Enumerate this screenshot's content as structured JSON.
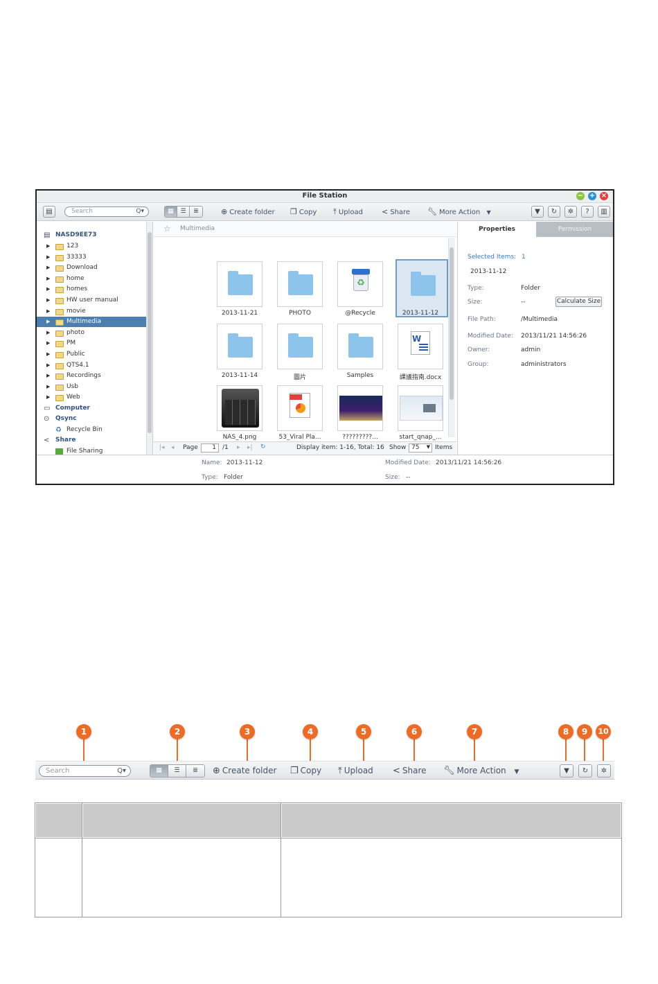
{
  "window": {
    "title": "File Station",
    "controls": {
      "minimize": "−",
      "maximize": "+",
      "close": "×"
    }
  },
  "toolbar": {
    "search_placeholder": "Search",
    "search_icon": "Q▾",
    "view_modes": [
      "thumbnail-view-icon",
      "list-view-icon",
      "detail-view-icon"
    ],
    "create_folder": "Create folder",
    "copy": "Copy",
    "upload": "Upload",
    "share": "Share",
    "more_action": "More Action",
    "right_icons": [
      "filter-icon",
      "refresh-icon",
      "settings-icon",
      "help-icon",
      "panel-icon"
    ]
  },
  "tree": {
    "root": "NASD9EE73",
    "items": [
      "123",
      "33333",
      "Download",
      "home",
      "homes",
      "HW user manual",
      "movie",
      "Multimedia",
      "photo",
      "PM",
      "Public",
      "QTS4.1",
      "Recordings",
      "Usb",
      "Web"
    ],
    "selected_index": 7,
    "computer": "Computer",
    "qsync": "Qsync",
    "recycle_bin": "Recycle Bin",
    "share": "Share",
    "file_sharing": "File Sharing"
  },
  "center": {
    "breadcrumb": "Multimedia",
    "files": [
      {
        "name": "2013-11-21",
        "kind": "folder"
      },
      {
        "name": "PHOTO",
        "kind": "folder"
      },
      {
        "name": "@Recycle",
        "kind": "recycle"
      },
      {
        "name": "2013-11-12",
        "kind": "folder",
        "selected": true
      },
      {
        "name": "2013-11-14",
        "kind": "folder"
      },
      {
        "name": "圖片",
        "kind": "folder"
      },
      {
        "name": "Samples",
        "kind": "folder"
      },
      {
        "name": "課議指南.docx",
        "kind": "docx"
      },
      {
        "name": "NAS_4.png",
        "kind": "nas"
      },
      {
        "name": "53_Viral Pla...",
        "kind": "pdf"
      },
      {
        "name": "?????????...",
        "kind": "image-dark"
      },
      {
        "name": "start_qnap_...",
        "kind": "image-light"
      }
    ],
    "pager": {
      "page_label": "Page",
      "page_value": "1",
      "page_total": "/1",
      "display": "Display item: 1-16, Total: 16",
      "show_label": "Show",
      "show_value": "75",
      "items_label": "Items"
    }
  },
  "properties": {
    "tabs": [
      "Properties",
      "Permission"
    ],
    "selected_items_label": "Selected Items:",
    "selected_items_value": "1",
    "name": "2013-11-12",
    "type_label": "Type:",
    "type_value": "Folder",
    "size_label": "Size:",
    "size_value": "--",
    "calc_button": "Calculate Size",
    "path_label": "File Path:",
    "path_value": "/Multimedia",
    "modified_label": "Modified Date:",
    "modified_value": "2013/11/21 14:56:26",
    "owner_label": "Owner:",
    "owner_value": "admin",
    "group_label": "Group:",
    "group_value": "administrators"
  },
  "statusbar": {
    "name_label": "Name:",
    "name_value": "2013-11-12",
    "type_label": "Type:",
    "type_value": "Folder",
    "modified_label": "Modified Date:",
    "modified_value": "2013/11/21 14:56:26",
    "size_label": "Size:",
    "size_value": "--"
  },
  "annotated_toolbar": {
    "search_placeholder": "Search",
    "search_icon": "Q▾",
    "create_folder": "Create folder",
    "copy": "Copy",
    "upload": "Upload",
    "share": "Share",
    "more_action": "More Action",
    "callouts": [
      "1",
      "2",
      "3",
      "4",
      "5",
      "6",
      "7",
      "8",
      "9",
      "10"
    ]
  },
  "colors": {
    "accent": "#4a7fb0",
    "callout": "#ee6b26",
    "folder_thumb": "#8cc4ec",
    "table_header": "#c9c9c9"
  }
}
